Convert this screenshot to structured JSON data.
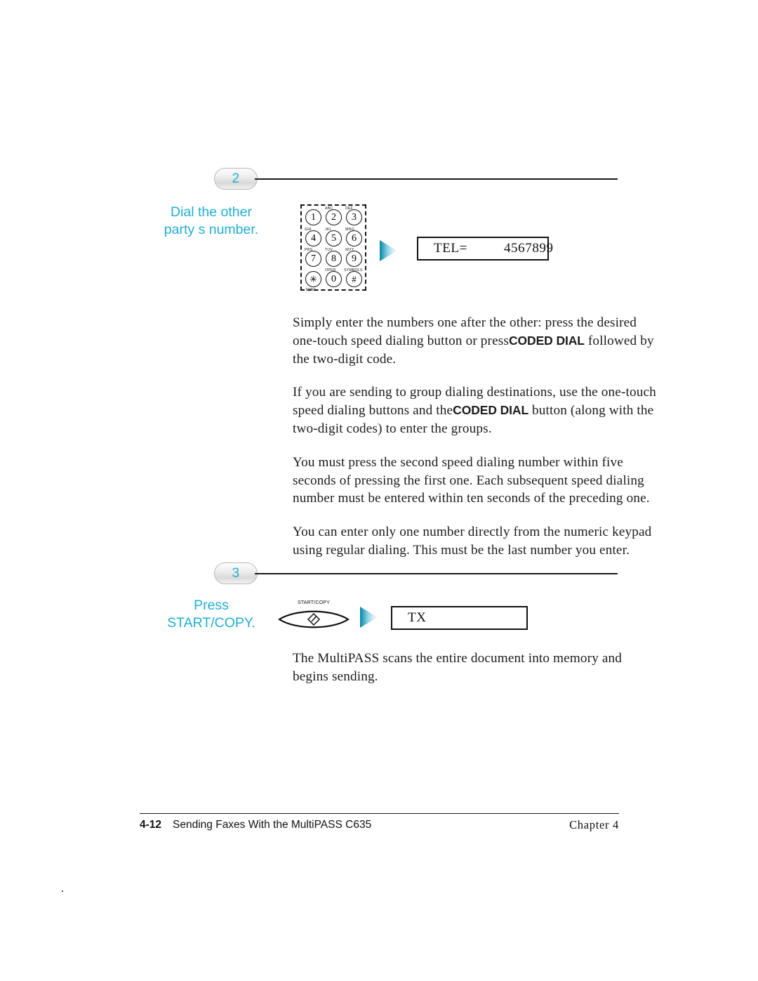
{
  "document": {
    "title": "Sending Faxes With the MultiPASS C635",
    "accent_color": "#21aed0",
    "text_color": "#1c1c1c"
  },
  "steps": [
    {
      "number": "2",
      "lead_line1": "Dial the other",
      "lead_line2": "party s number.",
      "paragraphs": [
        {
          "segments": [
            "Simply enter the numbers one after the other: press the desired one-touch speed dialing button or press",
            "CODED DIAL",
            "followed by the two-digit code."
          ]
        },
        {
          "segments": [
            "If you are sending to group dialing destinations, use the one-touch speed dialing buttons and the",
            "CODED DIAL",
            "button (along with the two-digit codes) to enter the groups."
          ]
        },
        {
          "text": "You must press the second speed dialing number within five seconds of pressing the first one. Each subsequent speed dialing number must be entered within ten seconds of the preceding one."
        },
        {
          "text": "You can enter only one number directly from the numeric keypad using regular dialing. This must be the last number you enter."
        }
      ]
    },
    {
      "number": "3",
      "lead_line1": "Press",
      "lead_line2": "START/COPY.",
      "paragraphs": [
        {
          "text": "The MultiPASS scans the entire document into memory and begins sending."
        }
      ]
    }
  ],
  "keypad": {
    "keys": [
      {
        "digit": "1",
        "caption": "",
        "caption_pos": "none"
      },
      {
        "digit": "2",
        "caption": "ABC",
        "caption_pos": "top"
      },
      {
        "digit": "3",
        "caption": "DEF",
        "caption_pos": "top"
      },
      {
        "digit": "4",
        "caption": "GHI",
        "caption_pos": "top"
      },
      {
        "digit": "5",
        "caption": "JKL",
        "caption_pos": "top"
      },
      {
        "digit": "6",
        "caption": "MNO",
        "caption_pos": "top"
      },
      {
        "digit": "7",
        "caption": "PRS",
        "caption_pos": "top"
      },
      {
        "digit": "8",
        "caption": "TUV",
        "caption_pos": "top"
      },
      {
        "digit": "9",
        "caption": "WXY",
        "caption_pos": "top"
      },
      {
        "digit": "✳",
        "caption": "TONE",
        "caption_pos": "bottom"
      },
      {
        "digit": "0",
        "caption": "OPER",
        "caption_pos": "top"
      },
      {
        "digit": "#",
        "caption": "SYMBOLS",
        "caption_pos": "top"
      }
    ]
  },
  "displays": {
    "tel": {
      "label": "TEL=",
      "value": "4567899"
    },
    "tx": {
      "label": "TX",
      "value": ""
    }
  },
  "panel_button": {
    "label": "START/COPY"
  },
  "footer": {
    "page_number": "4-12",
    "section": "Sending Faxes With the MultiPASS C635",
    "chapter": "Chapter 4"
  }
}
